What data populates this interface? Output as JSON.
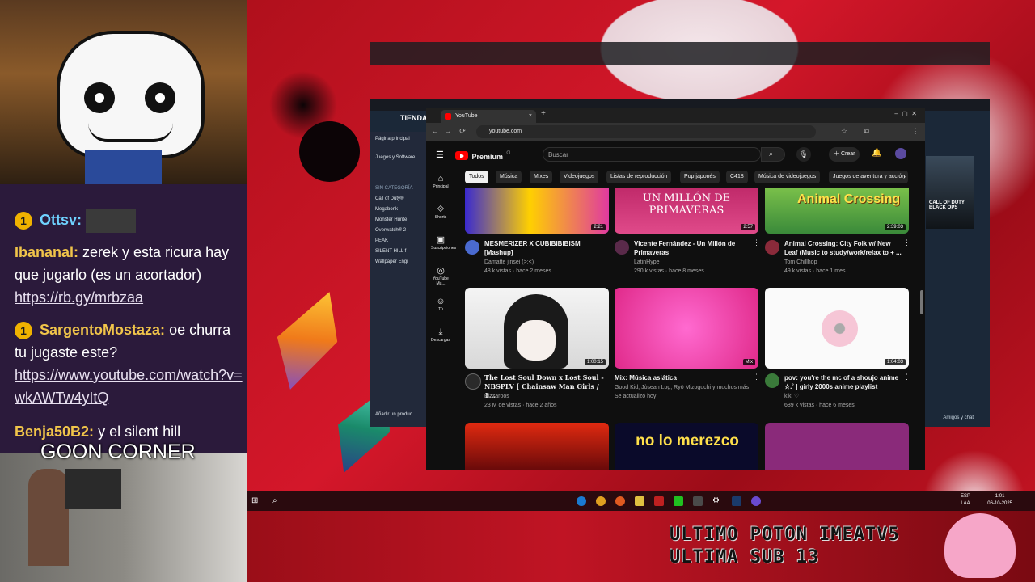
{
  "stream": {
    "chat": [
      {
        "user": "Ottsv:",
        "text": ""
      },
      {
        "user": "Ibananal:",
        "text": "zerek y esta ricura hay que jugarlo (es un acortador)",
        "link": "https://rb.gy/mrbzaa"
      },
      {
        "user": "SargentoMostaza:",
        "text": "oe churra tu jugaste este?",
        "link": "https://www.youtube.com/watch?v=wkAWTw4yItQ"
      },
      {
        "user": "Benja50B2:",
        "text": "y el silent hill"
      }
    ],
    "badge": "1",
    "goon_label": "GOON CORNER",
    "overlay_line1": "ULTIMO POTON IMEATV5",
    "overlay_line2": "ULTIMA SUB 13"
  },
  "steam": {
    "title": "TIENDA",
    "home": "Página principal",
    "filter": "Juegos y Software",
    "category": "SIN CATEGORÍA",
    "games": [
      "Call of Duty®",
      "Megabonk",
      "Monster Hunte",
      "Overwatch® 2",
      "PEAK",
      "SILENT HILL f",
      "Wallpaper Engi"
    ],
    "add_game": "Añadir un produc",
    "friends": "Amigos y chat",
    "right_card_title": "CALL OF DUTY BLACK OPS"
  },
  "browser": {
    "tab_title": "YouTube",
    "url": "youtube.com"
  },
  "youtube": {
    "logo": "Premium",
    "logo_sup": "CL",
    "search_placeholder": "Buscar",
    "create": "Crear",
    "rail": [
      "Principal",
      "Shorts",
      "Suscripciones",
      "YouTube Mu...",
      "Tú",
      "Descargas"
    ],
    "chips": [
      "Todos",
      "Música",
      "Mixes",
      "Videojuegos",
      "Listas de reproducción",
      "Pop japonés",
      "C418",
      "Música de videojuegos",
      "Juegos de aventura y acción"
    ],
    "videos_row1": [
      {
        "title": "MESMERIZER X CUBIBIBIBISM [Mashup]",
        "channel": "Damatte jinsei (>:<)",
        "meta": "48 k vistas · hace 2 meses",
        "duration": "2:21",
        "thumb_text": ""
      },
      {
        "title": "Vicente Fernández - Un Millón de Primaveras",
        "channel": "LatinHype",
        "meta": "290 k vistas · hace 8 meses",
        "duration": "2:57",
        "thumb_text": "UN MILLÓN DE PRIMAVERAS"
      },
      {
        "title": "Animal Crossing: City Folk w/ New Leaf (Music to study/work/relax to + ...",
        "channel": "Tom Chillhop",
        "meta": "49 k vistas · hace 1 mes",
        "duration": "2:39:03",
        "thumb_text": "Animal Crossing"
      }
    ],
    "videos_row2": [
      {
        "title": "The Lost Soul Down x Lost Soul - NBSPLV [ Chainsaw Man Girls / 1...",
        "channel": "Pizzaroos",
        "meta": "23 M de vistas · hace 2 años",
        "duration": "1:00:15"
      },
      {
        "title": "Mix: Música asiática",
        "channel": "Good Kid, Jòsean Log, Ryō Mizoguchi y muchos más",
        "meta": "Se actualizó hoy",
        "duration": "Mix"
      },
      {
        "title": "pov: you're the mc of a shoujo anime ☆.˚ | girly 2000s anime playlist",
        "channel": "kiki ♡",
        "meta": "689 k vistas · hace 6 meses",
        "duration": "1:04:03"
      }
    ],
    "row3_thumb_text": "no lo merezco"
  },
  "taskbar": {
    "lang": "ESP",
    "region": "LAA",
    "time": "1:01",
    "date": "06-10-2025"
  }
}
